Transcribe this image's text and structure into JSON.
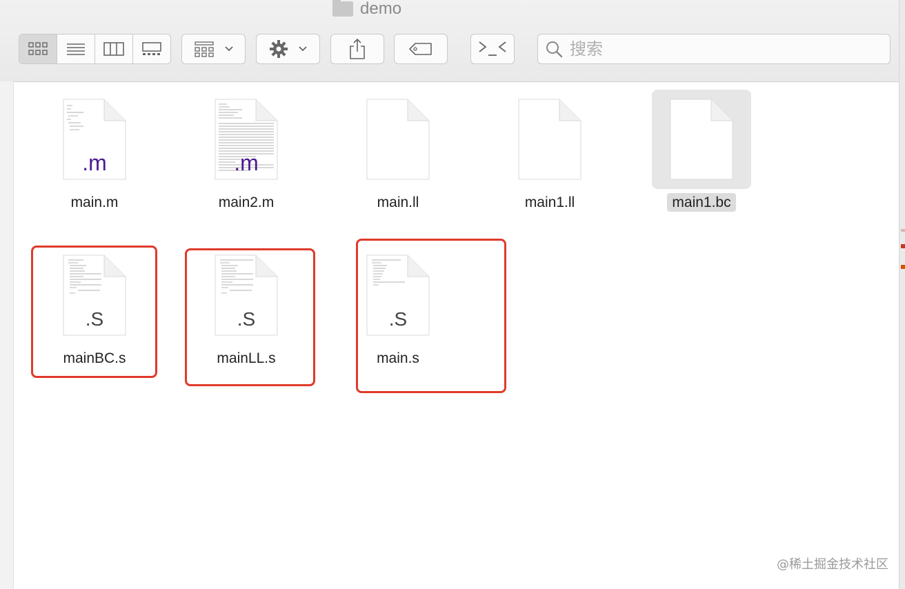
{
  "window": {
    "title": "demo"
  },
  "toolbar": {
    "search_placeholder": "搜索"
  },
  "files": [
    {
      "name": "main.m",
      "ext": ".m",
      "kind": "code"
    },
    {
      "name": "main2.m",
      "ext": ".m",
      "kind": "dense"
    },
    {
      "name": "main.ll",
      "ext": "",
      "kind": "blank"
    },
    {
      "name": "main1.ll",
      "ext": "",
      "kind": "blank"
    },
    {
      "name": "main1.bc",
      "ext": "",
      "kind": "blank",
      "selected": true
    },
    {
      "name": "mainBC.s",
      "ext": ".S",
      "kind": "code",
      "highlighted": true
    },
    {
      "name": "mainLL.s",
      "ext": ".S",
      "kind": "code",
      "highlighted": true
    },
    {
      "name": "main.s",
      "ext": ".S",
      "kind": "code",
      "highlighted": true
    }
  ],
  "watermark": "@稀土掘金技术社区",
  "colors": {
    "highlight": "#e03a2b",
    "m_ext": "#4b1b90"
  }
}
